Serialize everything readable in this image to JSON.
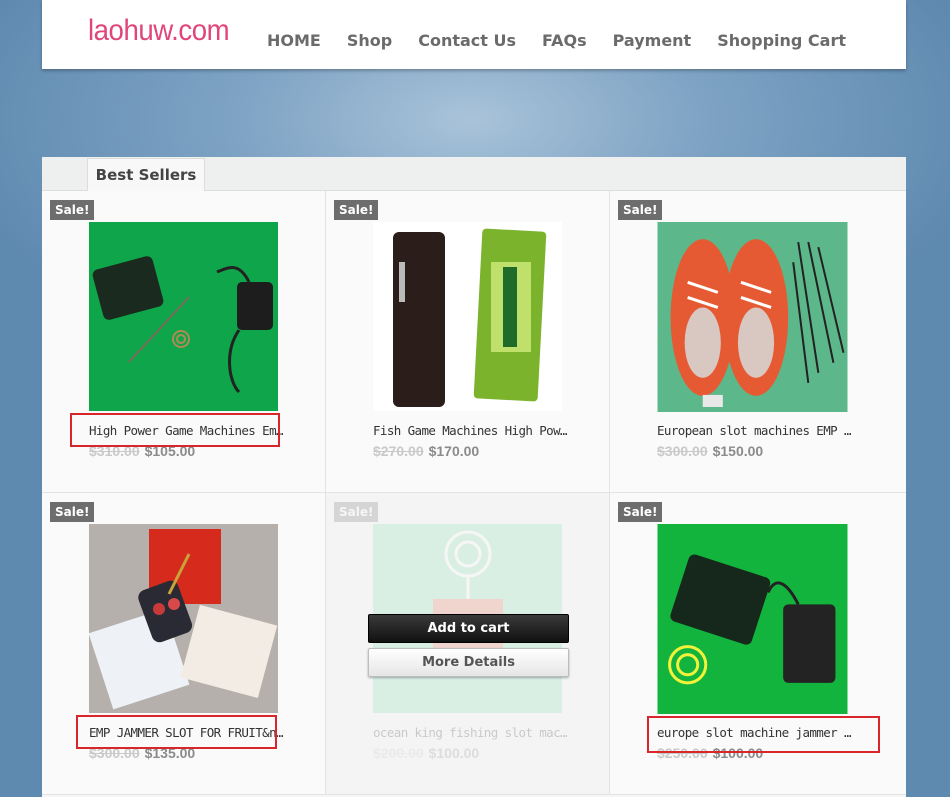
{
  "site": {
    "logo": "laohuw.com",
    "brand_color": "#e0457b"
  },
  "nav": [
    {
      "label": "HOME"
    },
    {
      "label": "Shop"
    },
    {
      "label": "Contact Us"
    },
    {
      "label": "FAQs"
    },
    {
      "label": "Payment"
    },
    {
      "label": "Shopping Cart"
    }
  ],
  "section": {
    "tab_label": "Best Sellers"
  },
  "products": [
    {
      "badge": "Sale!",
      "name": "High Power Game Machines Emp&nbs...",
      "old_price": "$310.00",
      "price": "$105.00",
      "image": "jammer-green"
    },
    {
      "badge": "Sale!",
      "name": "Fish Game Machines High Power EMP...",
      "old_price": "$270.00",
      "price": "$170.00",
      "image": "gum-device"
    },
    {
      "badge": "Sale!",
      "name": "European slot machines EMP Jammer 35...",
      "old_price": "$300.00",
      "price": "$150.00",
      "image": "shoes"
    },
    {
      "badge": "Sale!",
      "name": "EMP JAMMER SLOT FOR FRUIT&nbsp:...",
      "old_price": "$300.00",
      "price": "$135.00",
      "image": "cigarette-remote"
    },
    {
      "badge": "Sale!",
      "name": "ocean king fishing slot machine for Em...",
      "old_price": "$200.00",
      "price": "$100.00",
      "image": "coil-device"
    },
    {
      "badge": "Sale!",
      "name": "europe slot machine jammer for&nbsp;s...",
      "old_price": "$250.00",
      "price": "$100.00",
      "image": "jammer-yellow-coil"
    }
  ],
  "hover_actions": {
    "add_to_cart": "Add to cart",
    "more_details": "More Details"
  }
}
